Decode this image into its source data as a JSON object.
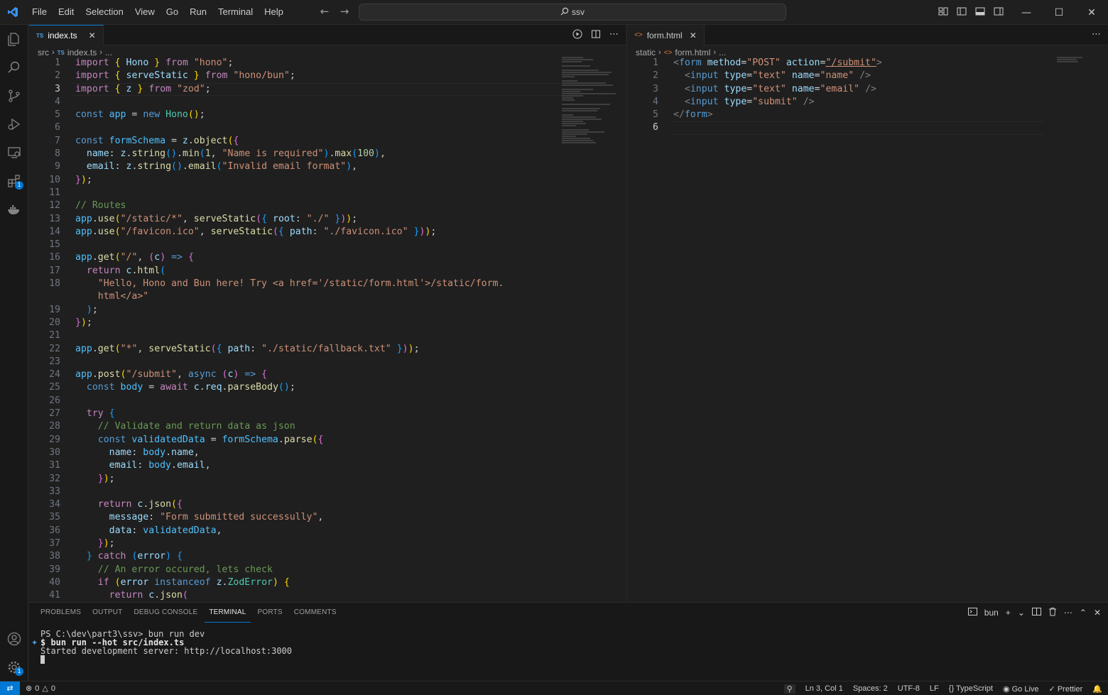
{
  "menu": [
    "File",
    "Edit",
    "Selection",
    "View",
    "Go",
    "Run",
    "Terminal",
    "Help"
  ],
  "search": {
    "text": "ssv"
  },
  "left_editor": {
    "tab_label": "index.ts",
    "tab_icon": "TS",
    "breadcrumb": [
      "src",
      "index.ts",
      "..."
    ]
  },
  "right_editor": {
    "tab_label": "form.html",
    "breadcrumb": [
      "static",
      "form.html",
      "..."
    ]
  },
  "panel": {
    "tabs": [
      "PROBLEMS",
      "OUTPUT",
      "DEBUG CONSOLE",
      "TERMINAL",
      "PORTS",
      "COMMENTS"
    ],
    "active_tab": "TERMINAL",
    "terminal_name": "bun",
    "terminal_lines": [
      "PS C:\\dev\\part3\\ssv> bun run dev",
      "$ bun run --hot src/index.ts",
      "Started development server: http://localhost:3000"
    ]
  },
  "status": {
    "errors": "0",
    "warnings": "0",
    "position": "Ln 3, Col 1",
    "spaces": "Spaces: 2",
    "encoding": "UTF-8",
    "eol": "LF",
    "language": "TypeScript",
    "golive": "Go Live",
    "prettier": "Prettier"
  },
  "badges": {
    "extensions": "1",
    "settings": "1"
  },
  "colors": {
    "accent": "#0078d4",
    "background": "#1f1f1f"
  }
}
